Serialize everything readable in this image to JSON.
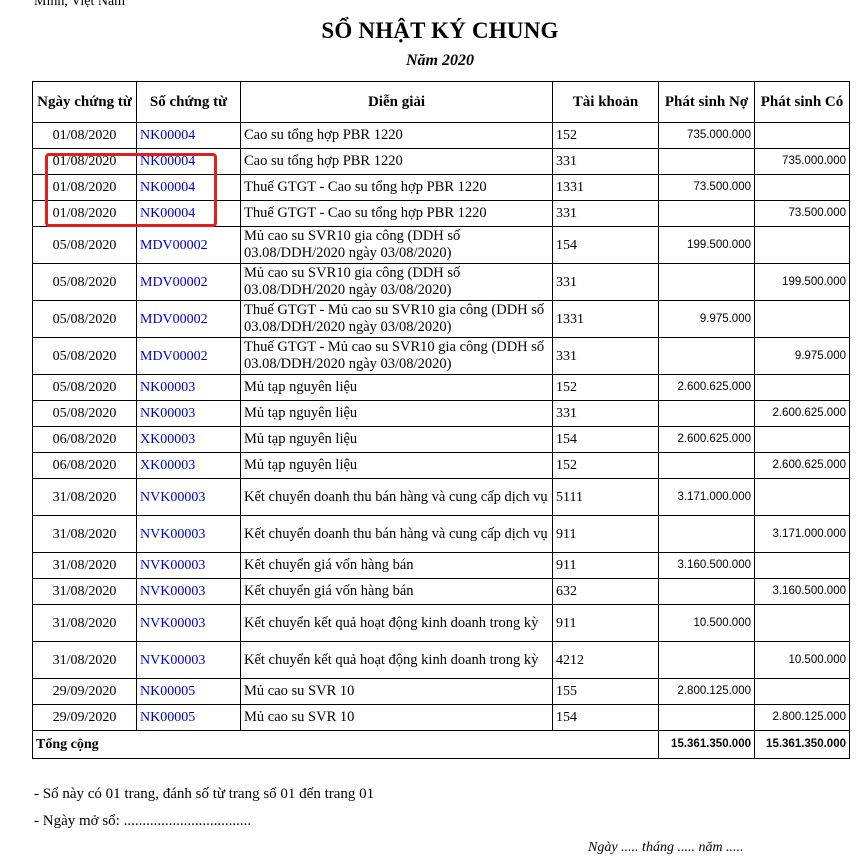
{
  "header": {
    "top_text": "Minh, Việt Nam",
    "title": "SỔ NHẬT KÝ CHUNG",
    "subtitle": "Năm 2020"
  },
  "table": {
    "columns": [
      "Ngày chứng từ",
      "Số chứng từ",
      "Diễn giải",
      "Tài khoản",
      "Phát sinh Nợ",
      "Phát sinh Có"
    ],
    "rows": [
      {
        "date": "01/08/2020",
        "voucher": "NK00004",
        "desc": "Cao su tổng hợp PBR 1220",
        "account": "152",
        "debit": "735.000.000",
        "credit": ""
      },
      {
        "date": "01/08/2020",
        "voucher": "NK00004",
        "desc": "Cao su tổng hợp PBR 1220",
        "account": "331",
        "debit": "",
        "credit": "735.000.000"
      },
      {
        "date": "01/08/2020",
        "voucher": "NK00004",
        "desc": "Thuế GTGT - Cao su tổng hợp PBR 1220",
        "account": "1331",
        "debit": "73.500.000",
        "credit": ""
      },
      {
        "date": "01/08/2020",
        "voucher": "NK00004",
        "desc": "Thuế GTGT - Cao su tổng hợp PBR 1220",
        "account": "331",
        "debit": "",
        "credit": "73.500.000"
      },
      {
        "date": "05/08/2020",
        "voucher": "MDV00002",
        "desc": "Mủ cao su SVR10 gia công (DDH số 03.08/DDH/2020 ngày 03/08/2020)",
        "account": "154",
        "debit": "199.500.000",
        "credit": ""
      },
      {
        "date": "05/08/2020",
        "voucher": "MDV00002",
        "desc": "Mủ cao su SVR10 gia công (DDH số 03.08/DDH/2020 ngày 03/08/2020)",
        "account": "331",
        "debit": "",
        "credit": "199.500.000"
      },
      {
        "date": "05/08/2020",
        "voucher": "MDV00002",
        "desc": "Thuế GTGT - Mủ cao su SVR10 gia công (DDH số 03.08/DDH/2020 ngày 03/08/2020)",
        "account": "1331",
        "debit": "9.975.000",
        "credit": ""
      },
      {
        "date": "05/08/2020",
        "voucher": "MDV00002",
        "desc": "Thuế GTGT - Mủ cao su SVR10 gia công (DDH số 03.08/DDH/2020 ngày 03/08/2020)",
        "account": "331",
        "debit": "",
        "credit": "9.975.000"
      },
      {
        "date": "05/08/2020",
        "voucher": "NK00003",
        "desc": "Mủ tạp nguyên liệu",
        "account": "152",
        "debit": "2.600.625.000",
        "credit": ""
      },
      {
        "date": "05/08/2020",
        "voucher": "NK00003",
        "desc": "Mủ tạp nguyên liệu",
        "account": "331",
        "debit": "",
        "credit": "2.600.625.000"
      },
      {
        "date": "06/08/2020",
        "voucher": "XK00003",
        "desc": "Mủ tạp nguyên liệu",
        "account": "154",
        "debit": "2.600.625.000",
        "credit": ""
      },
      {
        "date": "06/08/2020",
        "voucher": "XK00003",
        "desc": "Mủ tạp nguyên liệu",
        "account": "152",
        "debit": "",
        "credit": "2.600.625.000"
      },
      {
        "date": "31/08/2020",
        "voucher": "NVK00003",
        "desc": "Kết chuyển doanh thu bán hàng và cung cấp dịch vụ",
        "account": "5111",
        "debit": "3.171.000.000",
        "credit": ""
      },
      {
        "date": "31/08/2020",
        "voucher": "NVK00003",
        "desc": "Kết chuyển doanh thu bán hàng và cung cấp dịch vụ",
        "account": "911",
        "debit": "",
        "credit": "3.171.000.000"
      },
      {
        "date": "31/08/2020",
        "voucher": "NVK00003",
        "desc": "Kết chuyển giá vốn hàng bán",
        "account": "911",
        "debit": "3.160.500.000",
        "credit": ""
      },
      {
        "date": "31/08/2020",
        "voucher": "NVK00003",
        "desc": "Kết chuyển giá vốn hàng bán",
        "account": "632",
        "debit": "",
        "credit": "3.160.500.000"
      },
      {
        "date": "31/08/2020",
        "voucher": "NVK00003",
        "desc": "Kết chuyển kết quả hoạt động kinh doanh trong kỳ",
        "account": "911",
        "debit": "10.500.000",
        "credit": ""
      },
      {
        "date": "31/08/2020",
        "voucher": "NVK00003",
        "desc": "Kết chuyển kết quả hoạt động kinh doanh trong kỳ",
        "account": "4212",
        "debit": "",
        "credit": "10.500.000"
      },
      {
        "date": "29/09/2020",
        "voucher": "NK00005",
        "desc": "Mủ cao su SVR 10",
        "account": "155",
        "debit": "2.800.125.000",
        "credit": ""
      },
      {
        "date": "29/09/2020",
        "voucher": "NK00005",
        "desc": "Mủ cao su SVR 10",
        "account": "154",
        "debit": "",
        "credit": "2.800.125.000"
      }
    ],
    "total": {
      "label": "Tổng cộng",
      "debit": "15.361.350.000",
      "credit": "15.361.350.000"
    }
  },
  "notes": {
    "pages": "- Sổ này có 01 trang, đánh số từ trang số 01 đến trang 01",
    "open_date": "- Ngày mở sổ: ..................................",
    "date_line": "Ngày ..... tháng ..... năm ....."
  },
  "colors": {
    "voucher_link": "#0000cc",
    "highlight": "#e02020"
  }
}
